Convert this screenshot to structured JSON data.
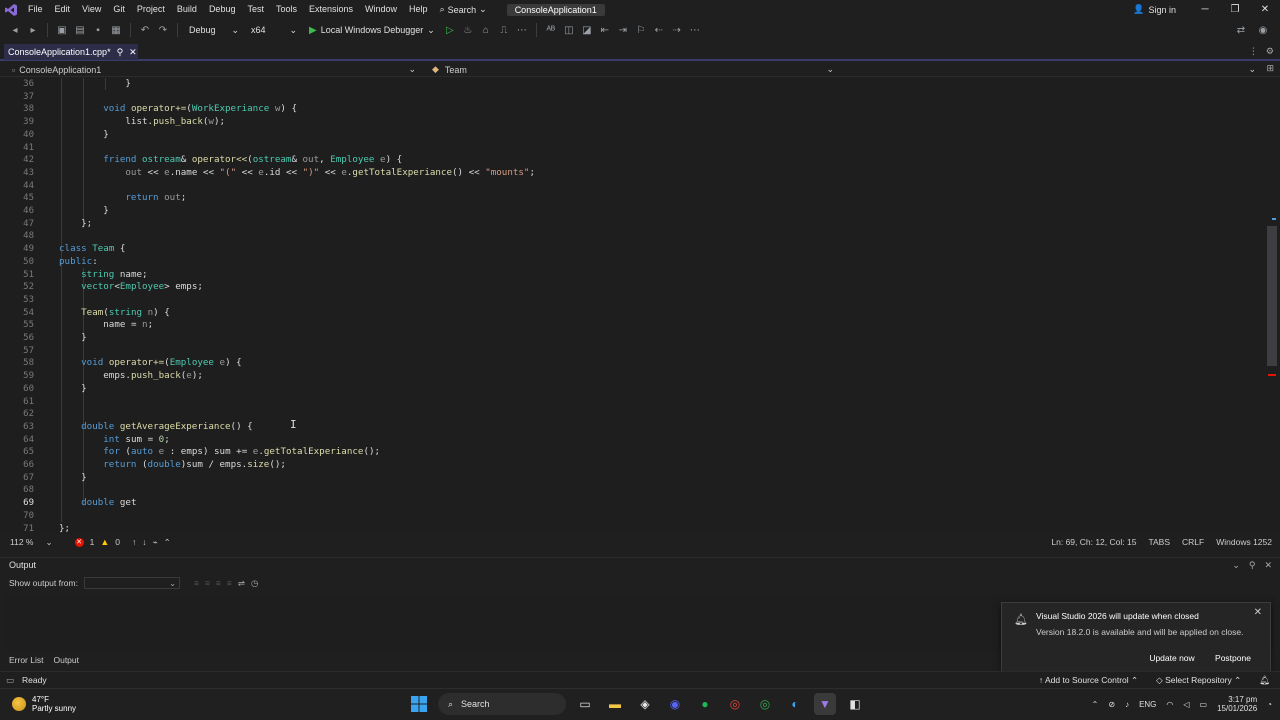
{
  "menubar": {
    "items": [
      "File",
      "Edit",
      "View",
      "Git",
      "Project",
      "Build",
      "Debug",
      "Test",
      "Tools",
      "Extensions",
      "Window",
      "Help"
    ],
    "search_label": "Search",
    "solution_name": "ConsoleApplication1",
    "signin_label": "Sign in"
  },
  "toolbar": {
    "configuration": "Debug",
    "platform": "x64",
    "debugger_label": "Local Windows Debugger"
  },
  "document_tab": {
    "label": "ConsoleApplication1.cpp*"
  },
  "navbar": {
    "project": "ConsoleApplication1",
    "scope": "Team"
  },
  "editor": {
    "line_numbers": [
      "36",
      "37",
      "38",
      "39",
      "40",
      "41",
      "42",
      "43",
      "44",
      "45",
      "46",
      "47",
      "48",
      "49",
      "50",
      "51",
      "52",
      "53",
      "54",
      "55",
      "56",
      "57",
      "58",
      "59",
      "60",
      "61",
      "62",
      "63",
      "64",
      "65",
      "66",
      "67",
      "68",
      "69",
      "70",
      "71"
    ],
    "current_line": "69"
  },
  "editor_status": {
    "zoom": "112 %",
    "errors": "1",
    "warnings": "0",
    "position": "Ln: 69, Ch: 12, Col: 15",
    "indent": "TABS",
    "eol": "CRLF",
    "encoding": "Windows 1252"
  },
  "output": {
    "title": "Output",
    "show_from_label": "Show output from:",
    "show_from_value": ""
  },
  "bottom_tabs": [
    "Error List",
    "Output"
  ],
  "notification": {
    "title": "Visual Studio 2026 will update when closed",
    "message": "Version 18.2.0 is available and will be applied on close.",
    "primary_button": "Update now",
    "secondary_button": "Postpone"
  },
  "status_bar": {
    "ready": "Ready",
    "source_control": "Add to Source Control",
    "repository": "Select Repository"
  },
  "taskbar": {
    "weather_temp": "47°F",
    "weather_desc": "Partly sunny",
    "search_label": "Search",
    "language": "ENG",
    "time": "3:17 pm",
    "date": "15/01/2026"
  },
  "colors": {
    "background": "#1f1f1f",
    "editor_bg": "#1e1e1e",
    "keyword": "#569cd6",
    "type": "#4ec9b0",
    "function": "#dcdcaa",
    "string": "#d69d85",
    "error": "#e51400"
  }
}
